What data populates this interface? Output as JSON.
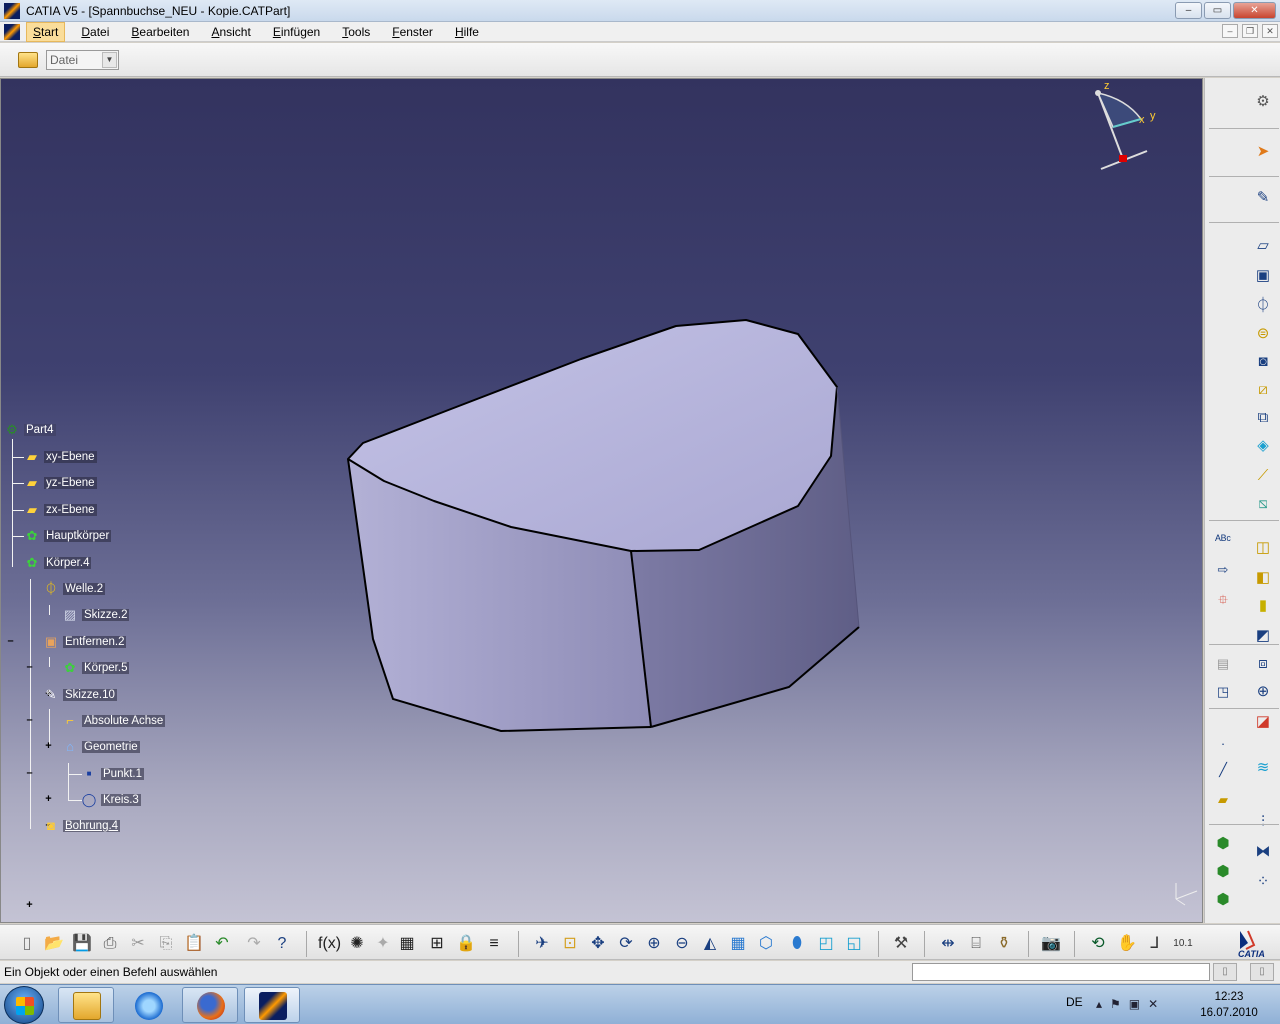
{
  "window": {
    "title": "CATIA V5 - [Spannbuchse_NEU - Kopie.CATPart]",
    "controls": [
      "–",
      "▭",
      "✕"
    ]
  },
  "menubar": {
    "items": [
      {
        "label": "Start",
        "active": true
      },
      {
        "label": "Datei"
      },
      {
        "label": "Bearbeiten"
      },
      {
        "label": "Ansicht"
      },
      {
        "label": "Einfügen"
      },
      {
        "label": "Tools"
      },
      {
        "label": "Fenster"
      },
      {
        "label": "Hilfe"
      }
    ],
    "mdi_controls": [
      "–",
      "❐",
      "✕"
    ]
  },
  "toolbar_top": {
    "combo_value": "Datei",
    "combo_arrow": "▼"
  },
  "compass": {
    "z_label": "z",
    "x_label": "x",
    "y_label": "y"
  },
  "axis_indicator": {
    "label": "z y x"
  },
  "tree": {
    "nodes": [
      {
        "label": "Part4",
        "icon": "part-icon"
      },
      {
        "label": "xy-Ebene",
        "icon": "plane-icon"
      },
      {
        "label": "yz-Ebene",
        "icon": "plane-icon"
      },
      {
        "label": "zx-Ebene",
        "icon": "plane-icon"
      },
      {
        "label": "Hauptkörper",
        "icon": "body-icon"
      },
      {
        "label": "Körper.4",
        "icon": "body-icon"
      },
      {
        "label": "Welle.2",
        "icon": "shaft-icon"
      },
      {
        "label": "Skizze.2",
        "icon": "sketch-icon"
      },
      {
        "label": "Entfernen.2",
        "icon": "remove-icon"
      },
      {
        "label": "Körper.5",
        "icon": "body-icon"
      },
      {
        "label": "Skizze.10",
        "icon": "sketch-icon"
      },
      {
        "label": "Absolute Achse",
        "icon": "axis-icon"
      },
      {
        "label": "Geometrie",
        "icon": "geometry-icon"
      },
      {
        "label": "Punkt.1",
        "icon": "point-icon"
      },
      {
        "label": "Kreis.3",
        "icon": "circle-icon"
      },
      {
        "label": "Bohrung.4",
        "icon": "hole-icon"
      }
    ]
  },
  "statusbar": {
    "message": "Ein Objekt oder einen Befehl auswählen"
  },
  "catia_logo": {
    "text": "CATIA"
  },
  "taskbar": {
    "language": "DE",
    "time": "12:23",
    "date": "16.07.2010"
  },
  "colors": {
    "viewport_top": "#33335f",
    "viewport_bottom": "#c4c3d4",
    "tree_text": "#ffffff",
    "part_face_top": "#b7b5dc",
    "part_face_side": "#8f8db8"
  }
}
